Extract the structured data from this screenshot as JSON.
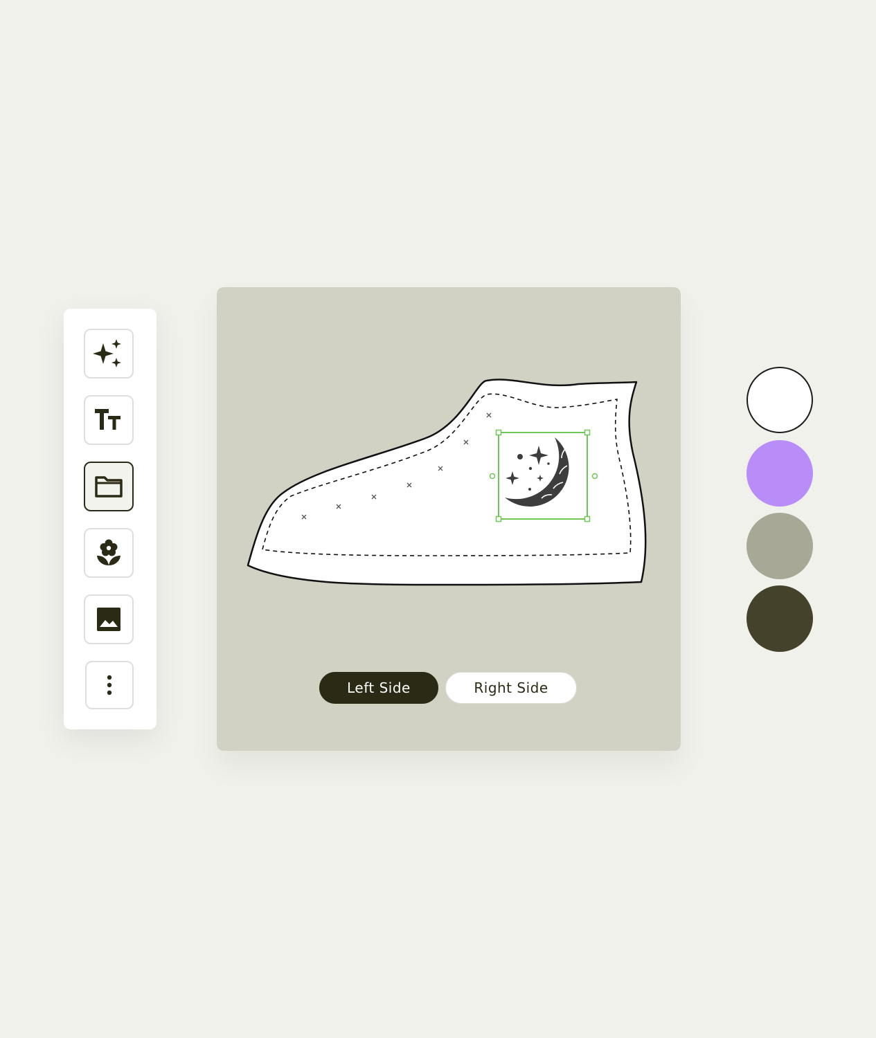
{
  "toolbar": {
    "tools": [
      {
        "name": "sparkles-icon",
        "label": "AI effects"
      },
      {
        "name": "text-icon",
        "label": "Text"
      },
      {
        "name": "folder-icon",
        "label": "Uploads",
        "active": true
      },
      {
        "name": "flower-icon",
        "label": "Graphics"
      },
      {
        "name": "image-icon",
        "label": "Images"
      },
      {
        "name": "more-vertical-icon",
        "label": "More"
      }
    ]
  },
  "canvas": {
    "background": "#d1d1c4",
    "product": "high-top-sneaker",
    "selected_graphic": "moon-stars-icon",
    "selection_color": "#6fc653",
    "sides": {
      "left_label": "Left Side",
      "right_label": "Right Side",
      "active": "left"
    }
  },
  "swatches": [
    {
      "name": "white",
      "color": "#ffffff",
      "selected": true
    },
    {
      "name": "lavender",
      "color": "#b98df8"
    },
    {
      "name": "sage-gray",
      "color": "#a8a896"
    },
    {
      "name": "dark-olive",
      "color": "#44422a"
    }
  ]
}
